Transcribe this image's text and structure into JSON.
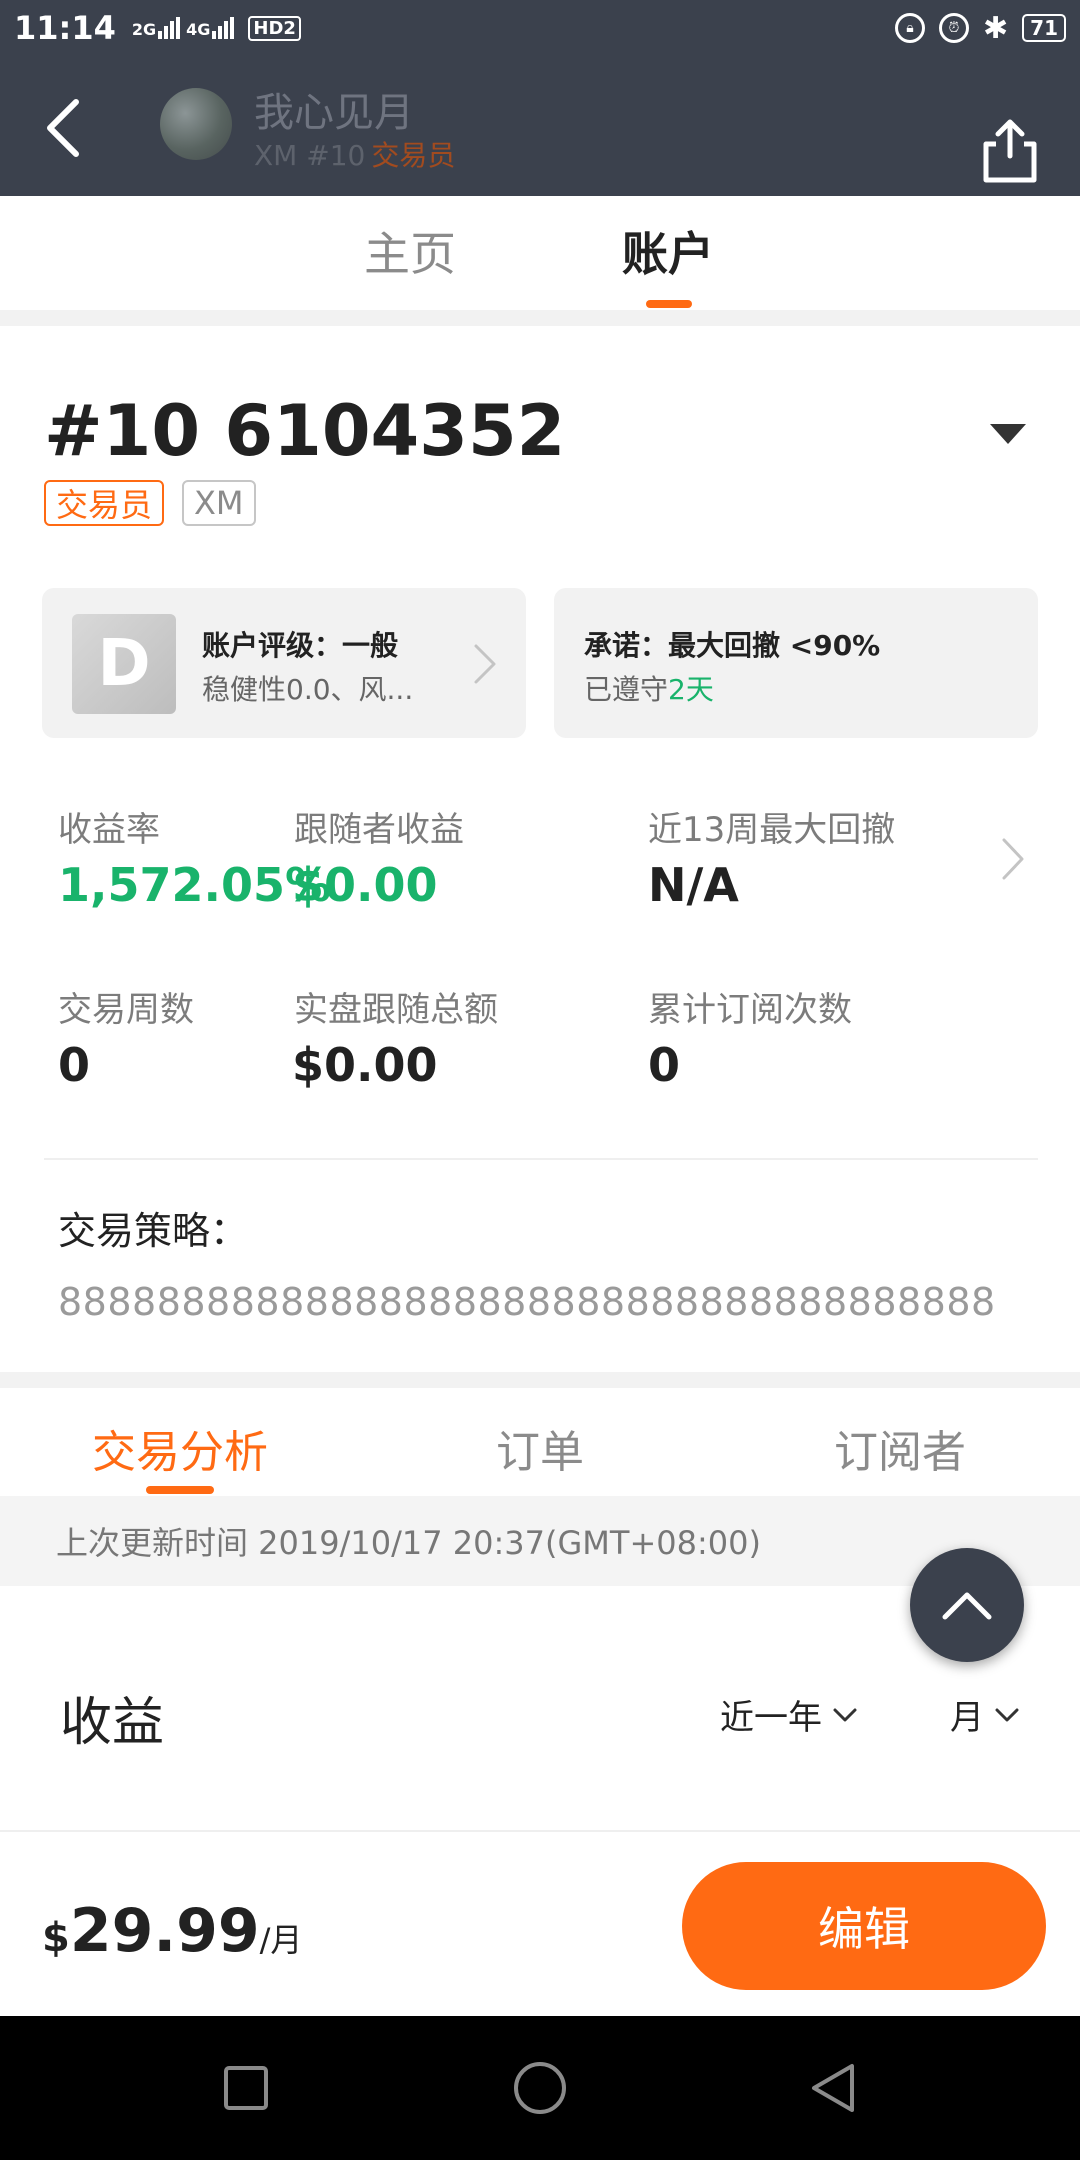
{
  "status_bar": {
    "time": "11:14",
    "sim1": "2G",
    "sim2": "4G",
    "hd": "HD2",
    "battery": "71"
  },
  "header": {
    "name": "我心见月",
    "broker_rank": "XM #10",
    "role": "交易员"
  },
  "main_tabs": [
    {
      "label": "主页",
      "active": false
    },
    {
      "label": "账户",
      "active": true
    }
  ],
  "account": {
    "number": "#10 6104352",
    "tag_role": "交易员",
    "tag_broker": "XM"
  },
  "rating_card": {
    "grade": "D",
    "title": "账户评级：一般",
    "subtitle": "稳健性0.0、风..."
  },
  "promise_card": {
    "title": "承诺：最大回撤 <90%",
    "kept_prefix": "已遵守",
    "kept_value": "2天"
  },
  "stats": [
    {
      "label": "收益率",
      "value": "1,572.05%"
    },
    {
      "label": "跟随者收益",
      "value": "$0.00"
    },
    {
      "label": "近13周最大回撤",
      "value": "N/A"
    },
    {
      "label": "交易周数",
      "value": "0"
    },
    {
      "label": "实盘跟随总额",
      "value": "$0.00"
    },
    {
      "label": "累计订阅次数",
      "value": "0"
    }
  ],
  "strategy": {
    "label": "交易策略：",
    "text": "88888888888888888888888888888888888888"
  },
  "sub_tabs": [
    {
      "label": "交易分析",
      "active": true
    },
    {
      "label": "订单",
      "active": false
    },
    {
      "label": "订阅者",
      "active": false
    }
  ],
  "update": {
    "text": "上次更新时间 2019/10/17 20:37(GMT+08:00)"
  },
  "earnings": {
    "title": "收益",
    "period_filter": "近一年",
    "granularity_filter": "月"
  },
  "bottom": {
    "currency": "$",
    "price": "29.99",
    "unit": "/月",
    "edit_label": "编辑"
  },
  "colors": {
    "accent": "#ff6a13",
    "positive": "#19b36b",
    "header_bg": "#3b414d"
  }
}
